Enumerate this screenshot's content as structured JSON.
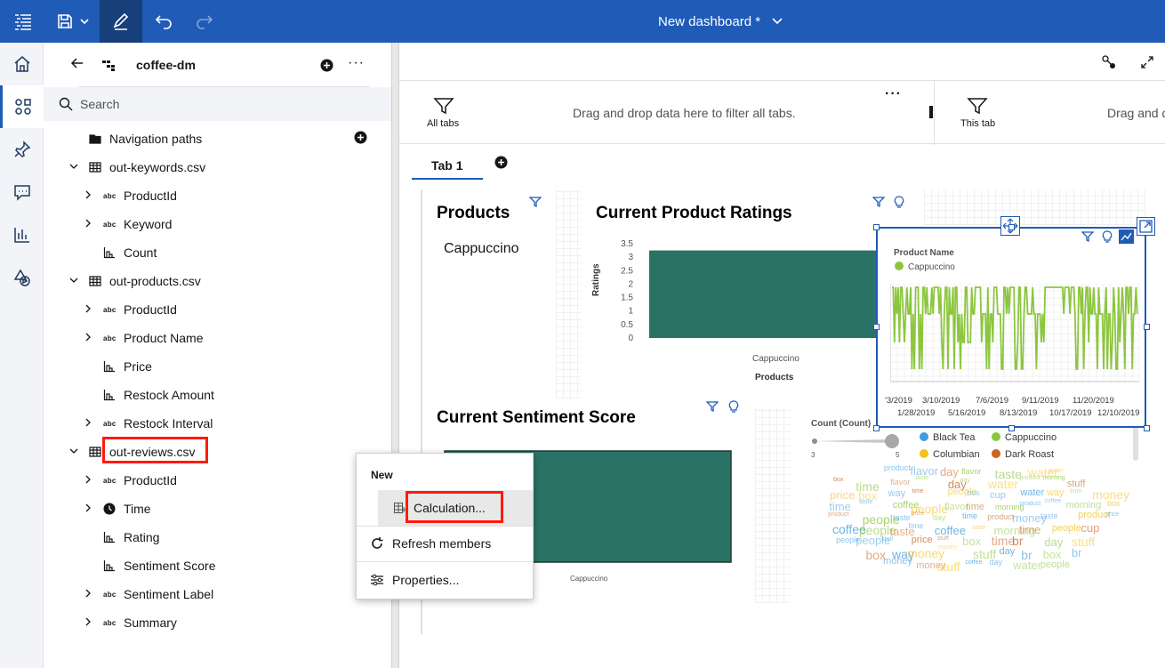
{
  "topbar": {
    "title": "New dashboard *"
  },
  "panel": {
    "module_name": "coffee-dm",
    "search_placeholder": "Search",
    "tree": [
      {
        "label": "Navigation paths",
        "kind": "folder"
      },
      {
        "label": "out-keywords.csv",
        "kind": "table"
      },
      {
        "label": "ProductId",
        "kind": "abc"
      },
      {
        "label": "Keyword",
        "kind": "abc"
      },
      {
        "label": "Count",
        "kind": "measure"
      },
      {
        "label": "out-products.csv",
        "kind": "table"
      },
      {
        "label": "ProductId",
        "kind": "abc"
      },
      {
        "label": "Product Name",
        "kind": "abc"
      },
      {
        "label": "Price",
        "kind": "measure"
      },
      {
        "label": "Restock Amount",
        "kind": "measure"
      },
      {
        "label": "Restock Interval",
        "kind": "abc"
      },
      {
        "label": "out-reviews.csv",
        "kind": "table"
      },
      {
        "label": "ProductId",
        "kind": "abc"
      },
      {
        "label": "Time",
        "kind": "time"
      },
      {
        "label": "Rating",
        "kind": "measure"
      },
      {
        "label": "Sentiment Score",
        "kind": "measure"
      },
      {
        "label": "Sentiment Label",
        "kind": "abc"
      },
      {
        "label": "Summary",
        "kind": "abc"
      }
    ]
  },
  "filters": {
    "all_tabs_label": "All tabs",
    "all_tabs_hint": "Drag and drop data here to filter all tabs.",
    "this_tab_label": "This tab",
    "this_tab_hint": "Drag and d"
  },
  "tabs": [
    {
      "label": "Tab 1"
    }
  ],
  "widgets": {
    "products": {
      "title": "Products",
      "value": "Cappuccino"
    },
    "ratings": {
      "title": "Current Product Ratings",
      "y_ticks": [
        "3.5",
        "3",
        "2.5",
        "2",
        "1.5",
        "1",
        "0.5",
        "0"
      ],
      "ylabel": "Ratings",
      "category": "Cappuccino",
      "xlabel": "Products"
    },
    "timeline": {
      "legend_title": "Product Name",
      "legend_item": "Cappuccino",
      "x_ticks_row1": [
        "'3/2019",
        "3/10/2019",
        "7/6/2019",
        "9/11/2019",
        "11/20/2019"
      ],
      "x_ticks_row2": [
        "1/28/2019",
        "5/16/2019",
        "8/13/2019",
        "10/17/2019",
        "12/10/2019"
      ]
    },
    "sentiment": {
      "title": "Current Sentiment Score",
      "category": "Cappuccino"
    },
    "wordcloud": {
      "count_label": "Count (Count)",
      "range_min": "3",
      "range_max": "5",
      "legend": [
        {
          "label": "Black Tea",
          "color": "#3d9be0"
        },
        {
          "label": "Cappuccino",
          "color": "#8cc63f"
        },
        {
          "label": "Columbian",
          "color": "#f1c21b"
        },
        {
          "label": "Dark Roast",
          "color": "#c8641e"
        }
      ],
      "words": [
        "way",
        "time",
        "taste",
        "stuff",
        "box",
        "water",
        "flavor",
        "people",
        "money",
        "product",
        "price",
        "Amazon",
        "morning",
        "cup",
        "br",
        "day",
        "coffee"
      ]
    }
  },
  "context_menu": {
    "section": "New",
    "calculation": "Calculation...",
    "refresh": "Refresh members",
    "properties": "Properties..."
  },
  "chart_data": [
    {
      "type": "bar",
      "title": "Current Product Ratings",
      "categories": [
        "Cappuccino"
      ],
      "values": [
        3.25
      ],
      "xlabel": "Products",
      "ylabel": "Ratings",
      "ylim": [
        0,
        3.5
      ]
    },
    {
      "type": "bar",
      "title": "Current Sentiment Score",
      "categories": [
        "Cappuccino"
      ],
      "values": [
        1
      ]
    }
  ]
}
